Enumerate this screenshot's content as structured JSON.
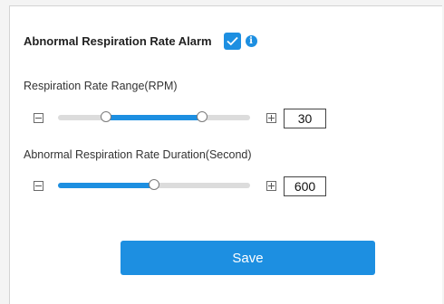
{
  "alarm": {
    "label": "Abnormal Respiration Rate Alarm",
    "checked": true,
    "info_icon": "info-icon",
    "info_glyph": "i"
  },
  "rate_range": {
    "label": "Respiration Rate Range(RPM)",
    "value": "30",
    "range_low_fraction": 0.25,
    "range_high_fraction": 0.75
  },
  "duration": {
    "label": "Abnormal Respiration Rate Duration(Second)",
    "value": "600",
    "fraction": 0.5
  },
  "save_label": "Save",
  "colors": {
    "accent": "#1d8fe1",
    "track": "#dcdcdc"
  }
}
